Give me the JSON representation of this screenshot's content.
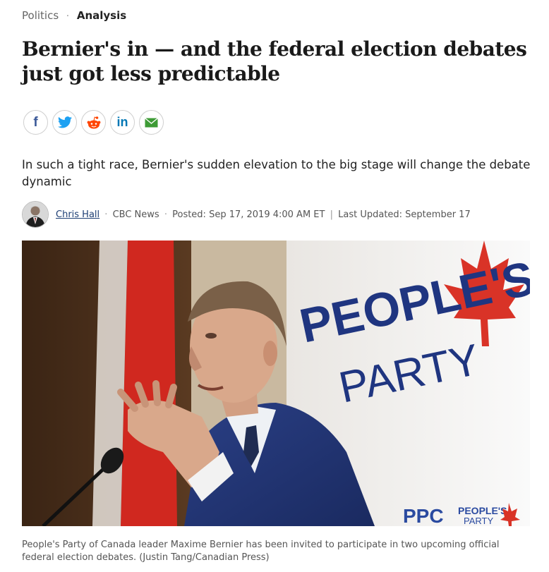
{
  "breadcrumb": {
    "section": "Politics",
    "separator": "·",
    "category": "Analysis"
  },
  "headline": "Bernier's in — and the federal election debates just got less predictable",
  "share": [
    {
      "icon": "facebook-icon",
      "color": "#3b5998"
    },
    {
      "icon": "twitter-icon",
      "color": "#1da1f2"
    },
    {
      "icon": "reddit-icon",
      "color": "#ff4500"
    },
    {
      "icon": "linkedin-icon",
      "color": "#0077b5"
    },
    {
      "icon": "email-icon",
      "color": "#3d9b35"
    }
  ],
  "share_glyphs": {
    "facebook": "f",
    "linkedin": "in"
  },
  "dek": "In such a tight race, Bernier's sudden elevation to the big stage will change the debate dynamic",
  "byline": {
    "author": "Chris Hall",
    "outlet": "CBC News",
    "posted": "Posted: Sep 17, 2019 4:00 AM ET",
    "divider": "|",
    "updated": "Last Updated: September 17",
    "dot": "·"
  },
  "hero": {
    "banner_line1": "PEOPLE'S",
    "banner_line2": "PARTY",
    "podium_text1": "PPC",
    "podium_text2": "PEOPLE'S",
    "podium_text3": "PARTY"
  },
  "caption": "People's Party of Canada leader Maxime Bernier has been invited to participate in two upcoming official federal election debates. (Justin Tang/Canadian Press)"
}
